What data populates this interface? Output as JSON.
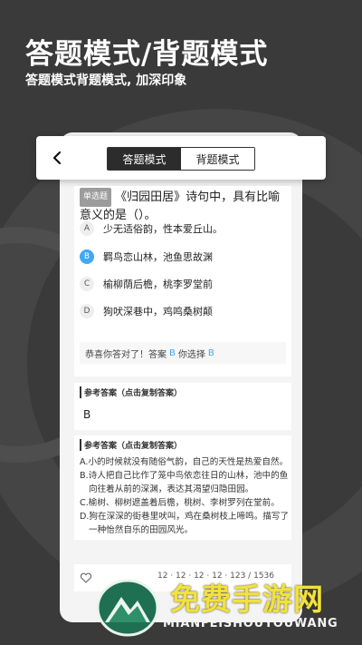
{
  "header": {
    "title": "答题模式/背题模式",
    "subtitle": "答题模式背题模式, 加深印象"
  },
  "topbar": {
    "back_icon": "chevron-left-icon",
    "tabs": [
      {
        "label": "答题模式",
        "active": true
      },
      {
        "label": "背题模式",
        "active": false
      }
    ]
  },
  "question": {
    "type_badge": "单选题",
    "text": "《归园田居》诗句中，具有比喻意义的是（）。",
    "options": [
      {
        "letter": "A",
        "text": "少无适俗韵，性本爱丘山。",
        "selected": false
      },
      {
        "letter": "B",
        "text": "羁鸟恋山林，池鱼思故渊",
        "selected": true
      },
      {
        "letter": "C",
        "text": "榆柳荫后檐，桃李罗堂前",
        "selected": false
      },
      {
        "letter": "D",
        "text": "狗吠深巷中，鸡鸣桑树颠",
        "selected": false
      }
    ],
    "result_prefix": "恭喜你答对了！答案",
    "answer_letter": "B",
    "result_mid": "你选择",
    "chosen_letter": "B"
  },
  "answer_section": {
    "title": "参考答案（点击复制答案）",
    "value": "B"
  },
  "explanation_section": {
    "title": "参考答案（点击复制答案）",
    "lines": [
      "A.小的时候就没有随俗气韵，自己的天性是热爱自然。",
      "B.诗人把自己比作了笼中鸟依恋往日的山林，池中的鱼",
      "向往着从前的深渊，表达其渴望归隐田园。",
      "C.榆树、柳树遮盖着后檐，桃树、李树罗列在堂前。",
      "D.狗在深深的街巷里吠叫，鸡在桑树枝上啼鸣。描写了",
      "一种怡然自乐的田园风光。"
    ]
  },
  "bottombar": {
    "heart_icon": "heart-outline-icon",
    "counts": "12 · 12 · 12 · 12 · 123 / 1536"
  },
  "watermark": {
    "title": "免费手游网",
    "subtitle": "MIANFEISHOUYOUWANG",
    "logo_icon": "mountain-logo-icon"
  },
  "colors": {
    "background": "#3a3a3a",
    "accent_blue": "#3fa9f5",
    "tab_active": "#2c2c2c",
    "watermark_yellow": "#f1e23c"
  }
}
